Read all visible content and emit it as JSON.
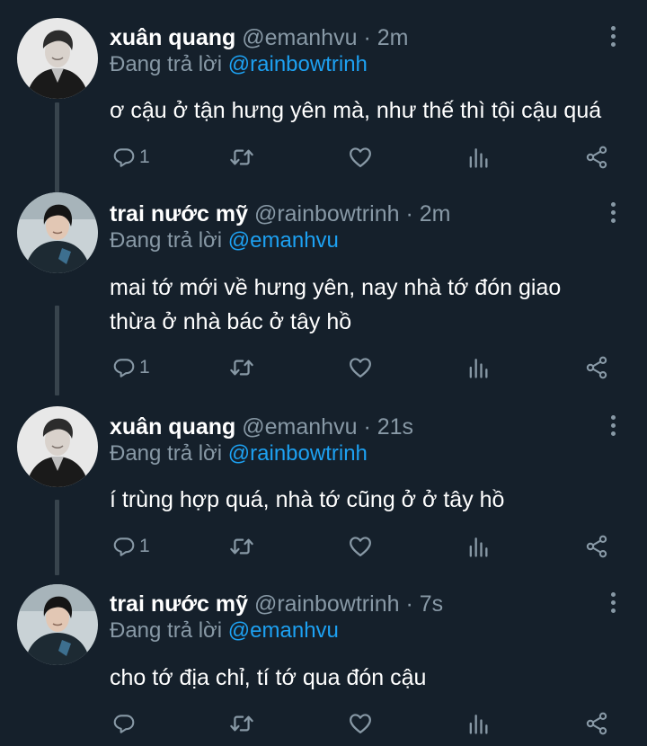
{
  "icons": {
    "reply": "reply-icon",
    "retweet": "retweet-icon",
    "like": "heart-icon",
    "analytics": "analytics-icon",
    "share": "share-icon",
    "more": "more-options-icon"
  },
  "colors": {
    "background": "#15202b",
    "secondary_text": "#8899a6",
    "link": "#1da1f2",
    "thread_line": "#38444d"
  },
  "tweets": [
    {
      "name": "xuân quang",
      "handle": "@emanhvu",
      "dot": "·",
      "time": "2m",
      "replying_prefix": "Đang trả lời",
      "replying_to": "@rainbowtrinh",
      "text": "ơ cậu ở tận hưng yên mà, như thế thì tội cậu quá",
      "reply_count": "1"
    },
    {
      "name": "trai nước mỹ",
      "handle": "@rainbowtrinh",
      "dot": "·",
      "time": "2m",
      "replying_prefix": "Đang trả lời",
      "replying_to": "@emanhvu",
      "text": "mai tớ mới về hưng yên, nay nhà tớ đón giao thừa ở nhà bác ở tây hồ",
      "reply_count": "1"
    },
    {
      "name": "xuân quang",
      "handle": "@emanhvu",
      "dot": "·",
      "time": "21s",
      "replying_prefix": "Đang trả lời",
      "replying_to": "@rainbowtrinh",
      "text": "í trùng hợp quá, nhà tớ cũng ở ở tây hồ",
      "reply_count": "1"
    },
    {
      "name": "trai nước mỹ",
      "handle": "@rainbowtrinh",
      "dot": "·",
      "time": "7s",
      "replying_prefix": "Đang trả lời",
      "replying_to": "@emanhvu",
      "text": "cho tớ địa chỉ, tí tớ qua đón cậu",
      "reply_count": ""
    }
  ]
}
